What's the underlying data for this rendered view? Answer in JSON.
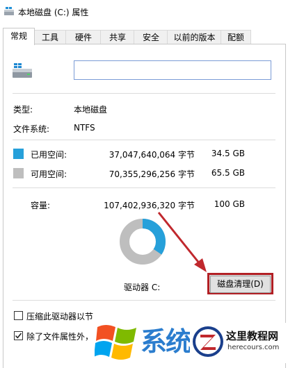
{
  "window": {
    "title": "本地磁盘 (C:) 属性"
  },
  "tabs": [
    {
      "label": "常规",
      "active": true
    },
    {
      "label": "工具",
      "active": false
    },
    {
      "label": "硬件",
      "active": false
    },
    {
      "label": "共享",
      "active": false
    },
    {
      "label": "安全",
      "active": false
    },
    {
      "label": "以前的版本",
      "active": false
    },
    {
      "label": "配额",
      "active": false
    }
  ],
  "general": {
    "volume_name_value": "",
    "type_label": "类型:",
    "type_value": "本地磁盘",
    "filesystem_label": "文件系统:",
    "filesystem_value": "NTFS",
    "used": {
      "label": "已用空间:",
      "bytes": "37,047,640,064 字节",
      "size": "34.5 GB",
      "color": "#26a0da"
    },
    "free": {
      "label": "可用空间:",
      "bytes": "70,355,296,256 字节",
      "size": "65.5 GB",
      "color": "#bebebe"
    },
    "capacity": {
      "label": "容量:",
      "bytes": "107,402,936,320 字节",
      "size": "100 GB"
    },
    "used_fraction": 0.345,
    "drive_label": "驱动器 C:",
    "cleanup_button": "磁盘清理(D)",
    "compress_label": "压缩此驱动器以节",
    "index_label": "除了文件属性外，",
    "compress_checked": false,
    "index_checked": true
  },
  "watermark": {
    "left_text": "系统之家",
    "site_name": "这里教程网",
    "site_url": "herecours.com"
  },
  "colors": {
    "annotation_red": "#c0282d",
    "accent_blue": "#26a0da"
  }
}
